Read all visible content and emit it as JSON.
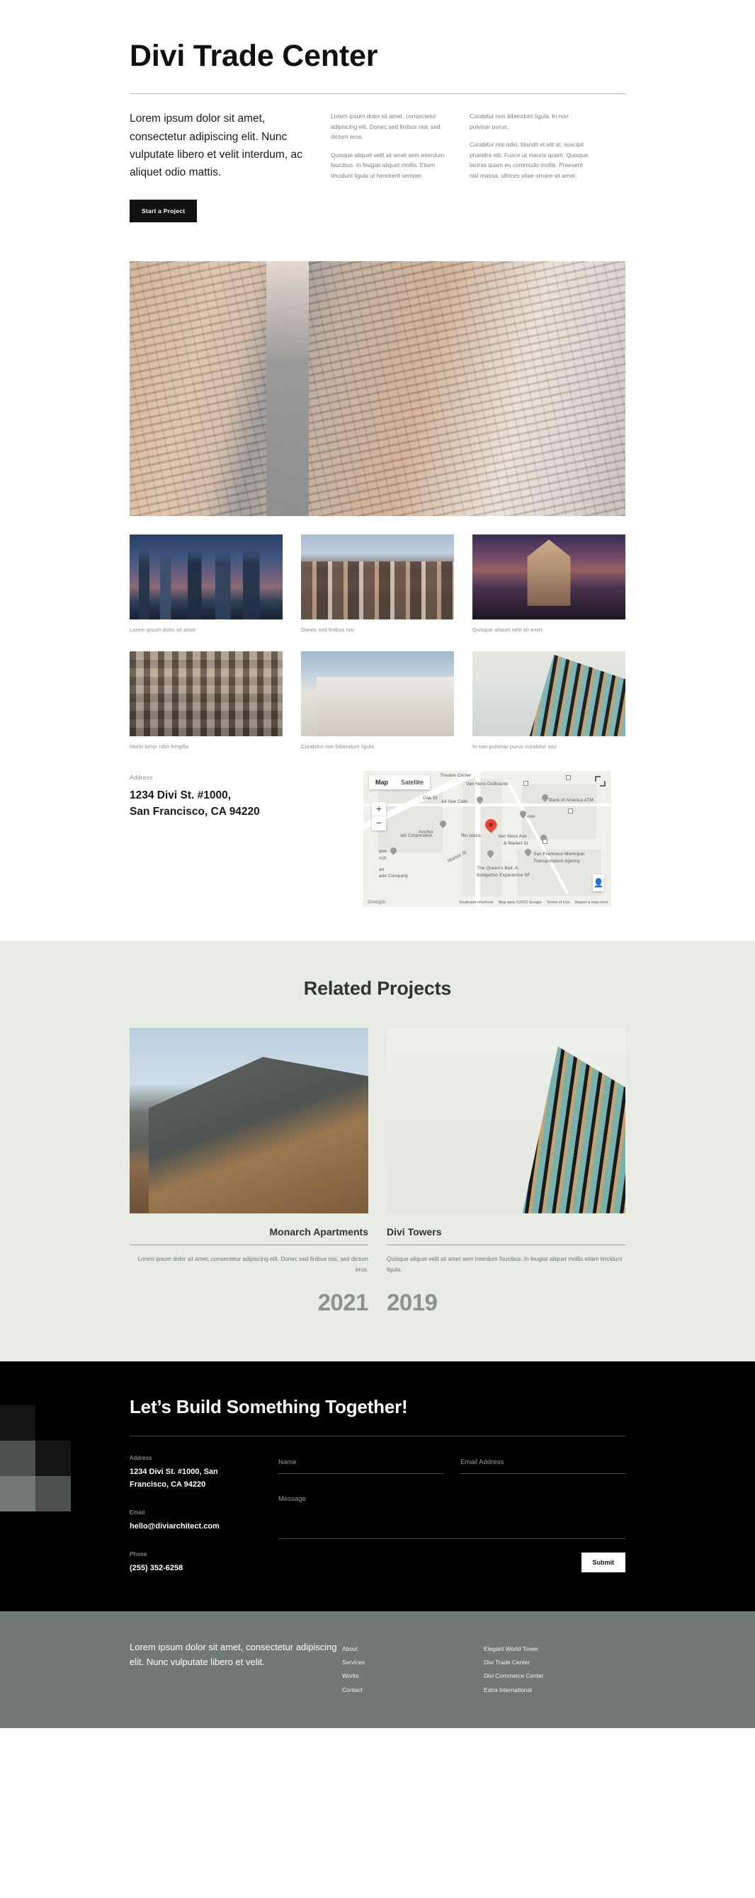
{
  "hero": {
    "title": "Divi Trade Center",
    "lead": "Lorem ipsum dolor sit amet, consectetur adipiscing elit. Nunc vulputate libero et velit interdum, ac aliquet odio mattis.",
    "col2_p1": "Lorem ipsum dolor sit amet, consectetur adipiscing elit. Donec sed finibus nisi, sed dictum eros.",
    "col2_p2": "Quisque aliquet velit sit amet sem interdum faucibus. In feugiat aliquet mollis. Etiam tincidunt ligula ut hendrerit semper.",
    "col3_p1": "Curabitur non bibendum ligula. In non pulvinar purus.",
    "col3_p2": "Curabitur nisi odio, blandit et elit at, suscipit pharetra elit. Fusce ut mauris quam. Quisque lacinia quam eu commodo mollis. Praesent nisl massa, ultrices vitae ornare sit amet.",
    "cta_button": "Start a Project"
  },
  "gallery": {
    "captions": [
      "Lorem ipsum dolor sit amet",
      "Donec sed finibus nisi",
      "Quisque aliquet velit sit amet",
      "Morbi tortor nibh fringilla",
      "Curabitur non bibendum ligula",
      "In non pulvinar purus curabitur nisi"
    ]
  },
  "address": {
    "label": "Address",
    "line1": "1234 Divi St. #1000,",
    "line2": "San Francisco, CA 94220"
  },
  "map": {
    "type_map": "Map",
    "type_satellite": "Satellite",
    "zoom_in": "+",
    "zoom_out": "−",
    "credit": "Google",
    "labels": [
      "Theatre Center",
      "Van Ness Outbound",
      "Oak St",
      "All Star Cafe",
      "Bank of America ATM",
      "Anchor",
      "one",
      "ark Corporation",
      "Riu plaza",
      "Van Ness Ave",
      "& Market St",
      "San Francisco Municipal",
      "Transportation Agency",
      "que",
      "nch",
      "an",
      "ade Company",
      "The Queen's Ball: A",
      "Bridgerton Experience SF"
    ],
    "street": "Market St",
    "footer": [
      "Keyboard shortcuts",
      "Map data ©2022 Google",
      "Terms of Use",
      "Report a map error"
    ]
  },
  "related": {
    "title": "Related Projects",
    "projects": [
      {
        "name": "Monarch Apartments",
        "desc": "Lorem ipsum dolor sit amet, consectetur adipiscing elit. Donec sed finibus nisi, sed dictum eros.",
        "year": "2021"
      },
      {
        "name": "Divi Towers",
        "desc": "Quisque aliquet velit sit amet sem interdum faucibus. In feugiat aliquet mollis etiam tincidunt ligula.",
        "year": "2019"
      }
    ]
  },
  "cta": {
    "title": "Let’s Build Something Together!",
    "address_label": "Address",
    "address_value": "1234 Divi St. #1000, San Francisco, CA 94220",
    "email_label": "Email",
    "email_value": "hello@diviarchitect.com",
    "phone_label": "Phone",
    "phone_value": "(255) 352-6258",
    "name_placeholder": "Name",
    "email_placeholder": "Email Address",
    "message_placeholder": "Message",
    "submit_label": "Submit"
  },
  "footer": {
    "about": "Lorem ipsum dolor sit amet, consectetur adipiscing elit. Nunc vulputate libero et velit.",
    "nav_primary": [
      "About",
      "Services",
      "Works",
      "Contact"
    ],
    "nav_projects": [
      "Elegant World Tower",
      "Divi Trade Center",
      "Divi Commerce Center",
      "Extra International"
    ]
  },
  "colors": {
    "dark": "#000000",
    "sage": "#e8ece4",
    "footer": "#6e7a73",
    "accent_pin": "#e8453c"
  }
}
